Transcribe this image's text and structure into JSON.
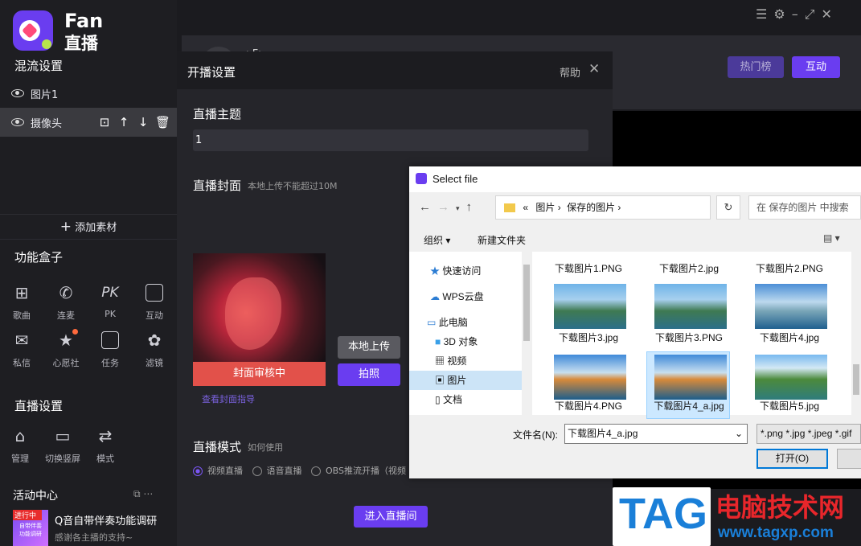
{
  "brand": {
    "name_en": "Fan",
    "name_cn": "直播"
  },
  "mix": {
    "title": "混流设置",
    "layers": [
      {
        "label": "图片1"
      },
      {
        "label": "摄像头"
      }
    ],
    "add_label": "添加素材"
  },
  "func": {
    "title": "功能盒子",
    "items": [
      {
        "label": "歌曲",
        "icon": "grid-icon"
      },
      {
        "label": "连麦",
        "icon": "phone-icon"
      },
      {
        "label": "PK",
        "icon": "pk-icon"
      },
      {
        "label": "互动",
        "icon": "chat-icon"
      },
      {
        "label": "私信",
        "icon": "mail-icon"
      },
      {
        "label": "心愿社",
        "icon": "wish-icon"
      },
      {
        "label": "任务",
        "icon": "task-icon"
      },
      {
        "label": "滤镜",
        "icon": "filter-icon"
      }
    ]
  },
  "live": {
    "title": "直播设置",
    "items": [
      {
        "label": "管理",
        "icon": "home-icon"
      },
      {
        "label": "切换竖屏",
        "icon": "rotate-icon"
      },
      {
        "label": "模式",
        "icon": "camera-mode-icon"
      }
    ]
  },
  "activity": {
    "title": "活动中心",
    "badge": "进行中",
    "thumb_line1": "自带伴奏",
    "thumb_line2": "功能调研",
    "headline": "Q音自带伴奏功能调研",
    "sub": "感谢各主播的支持~"
  },
  "header": {
    "hot_label": "热门榜",
    "interact_label": "互动",
    "partial_title": "ı Fı"
  },
  "modal": {
    "title": "开播设置",
    "help": "帮助",
    "topic_label": "直播主题",
    "topic_value": "1",
    "cover_label": "直播封面",
    "cover_hint": "本地上传不能超过10M",
    "cover_status": "封面审核中",
    "guide_link": "查看封面指导",
    "upload_label": "本地上传",
    "photo_label": "拍照",
    "mode_label": "直播模式",
    "mode_help": "如何使用",
    "modes": [
      {
        "label": "视频直播",
        "selected": true
      },
      {
        "label": "语音直播",
        "selected": false
      },
      {
        "label": "OBS推流开播（视频",
        "selected": false
      }
    ],
    "enter_label": "进入直播间"
  },
  "dialog": {
    "title": "Select file",
    "breadcrumb": [
      "«",
      "图片",
      "保存的图片"
    ],
    "search_placeholder": "在 保存的图片 中搜索",
    "organize": "组织",
    "new_folder": "新建文件夹",
    "tree": [
      "快速访问",
      "WPS云盘",
      "此电脑",
      "3D 对象",
      "视频",
      "图片",
      "文档"
    ],
    "files": [
      "下载图片1.PNG",
      "下载图片2.jpg",
      "下载图片2.PNG",
      "下载图片3.jpg",
      "下载图片3.PNG",
      "下载图片4.jpg",
      "下载图片4.PNG",
      "下载图片4_a.jpg",
      "下载图片5.jpg"
    ],
    "filename_label": "文件名(N):",
    "filename_value": "下载图片4_a.jpg",
    "filter_value": "*.png *.jpg *.jpeg *.gif",
    "open_label": "打开(O)"
  },
  "watermark": {
    "logo": "TAG",
    "cn": "电脑技术网",
    "url": "www.tagxp.com"
  },
  "colors": {
    "accent": "#6a3df0",
    "cover_status": "#e2514a",
    "preview": "#000000"
  }
}
